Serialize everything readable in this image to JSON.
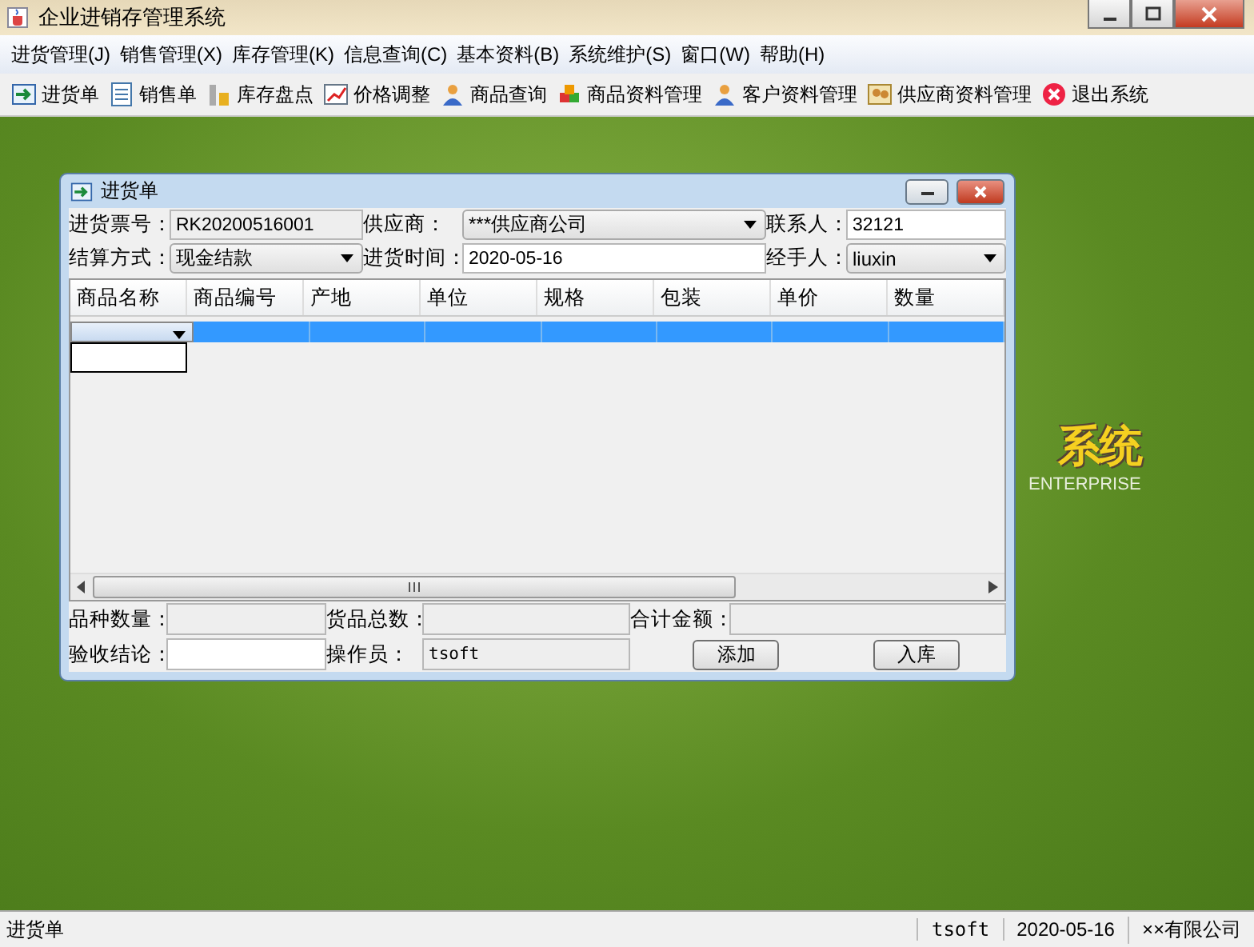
{
  "window": {
    "title": "企业进销存管理系统"
  },
  "menu": [
    {
      "label": "进货管理(J)"
    },
    {
      "label": "销售管理(X)"
    },
    {
      "label": "库存管理(K)"
    },
    {
      "label": "信息查询(C)"
    },
    {
      "label": "基本资料(B)"
    },
    {
      "label": "系统维护(S)"
    },
    {
      "label": "窗口(W)"
    },
    {
      "label": "帮助(H)"
    }
  ],
  "toolbar": [
    {
      "label": "进货单"
    },
    {
      "label": "销售单"
    },
    {
      "label": "库存盘点"
    },
    {
      "label": "价格调整"
    },
    {
      "label": "商品查询"
    },
    {
      "label": "商品资料管理"
    },
    {
      "label": "客户资料管理"
    },
    {
      "label": "供应商资料管理"
    },
    {
      "label": "退出系统"
    }
  ],
  "banner": {
    "title": "系统",
    "subtitle": "ENTERPRISE"
  },
  "dialog": {
    "title": "进货单",
    "fields": [
      {
        "label": "进货票号：",
        "kind": "readonly",
        "value": "RK20200516001"
      },
      {
        "label": "供应商：",
        "kind": "combo",
        "value": "***供应商公司"
      },
      {
        "label": "联系人：",
        "kind": "text",
        "value": "32121"
      },
      {
        "label": "结算方式：",
        "kind": "combo",
        "value": "现金结款"
      },
      {
        "label": "进货时间：",
        "kind": "text",
        "value": "2020-05-16"
      },
      {
        "label": "经手人：",
        "kind": "combo",
        "value": "liuxin"
      }
    ],
    "table": {
      "columns": [
        "商品名称",
        "商品编号",
        "产地",
        "单位",
        "规格",
        "包装",
        "单价",
        "数量"
      ],
      "rows": [
        {
          "selected": true,
          "editor_expanded": true
        }
      ]
    },
    "summary": [
      {
        "label": "品种数量：",
        "kind": "readonly"
      },
      {
        "label": "货品总数：",
        "kind": "readonly"
      },
      {
        "label": "合计金额：",
        "kind": "readonly"
      },
      {
        "label": "验收结论：",
        "kind": "text"
      },
      {
        "label": "操作员：",
        "kind": "readonly",
        "value": "tsoft"
      }
    ],
    "buttons": [
      "添加",
      "入库"
    ]
  },
  "status_bar": [
    "进货单",
    "tsoft",
    "2020-05-16",
    "××有限公司"
  ]
}
